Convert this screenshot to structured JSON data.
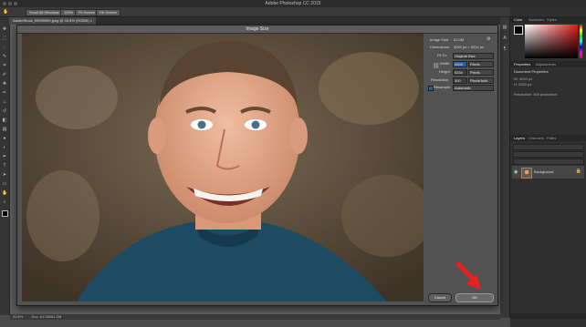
{
  "window": {
    "title": "Adobe Photoshop CC 2015"
  },
  "options_bar": {
    "buttons": [
      "Scroll All Windows",
      "100%",
      "Fit Screen",
      "Fill Screen"
    ]
  },
  "document_tab": {
    "label": "AdobeStock_99999999.jpeg @ 33.6% (RGB/8)"
  },
  "dialog": {
    "title": "Image Size",
    "image_size_label": "Image Size:",
    "image_size_value": "61.0M",
    "dimensions_label": "Dimensions:",
    "dimensions_value": "4000 px × 5334 px",
    "fit_to_label": "Fit To:",
    "fit_to_value": "Original Size",
    "width_label": "Width:",
    "width_value": "4000",
    "width_unit": "Pixels",
    "height_label": "Height:",
    "height_value": "5334",
    "height_unit": "Pixels",
    "resolution_label": "Resolution:",
    "resolution_value": "300",
    "resolution_unit": "Pixels/Inch",
    "resample_label": "Resample:",
    "resample_value": "Automatic",
    "cancel_label": "Cancel",
    "ok_label": "OK"
  },
  "status_bar": {
    "zoom": "33.6%",
    "doc": "Doc: 61.0M/61.0M"
  },
  "panels": {
    "color_tabs": [
      "Color",
      "Swatches",
      "Styles"
    ],
    "properties_tabs": [
      "Properties",
      "Adjustments"
    ],
    "properties_title": "Document Properties",
    "properties_w": "W: 4000 px",
    "properties_h": "H: 5334 px",
    "properties_res": "Resolution: 300 pixels/inch",
    "layers_tabs": [
      "Layers",
      "Channels",
      "Paths"
    ],
    "layer_name": "Background"
  },
  "colors": {
    "accent": "#2b5c9e",
    "arrow": "#e8211c"
  }
}
